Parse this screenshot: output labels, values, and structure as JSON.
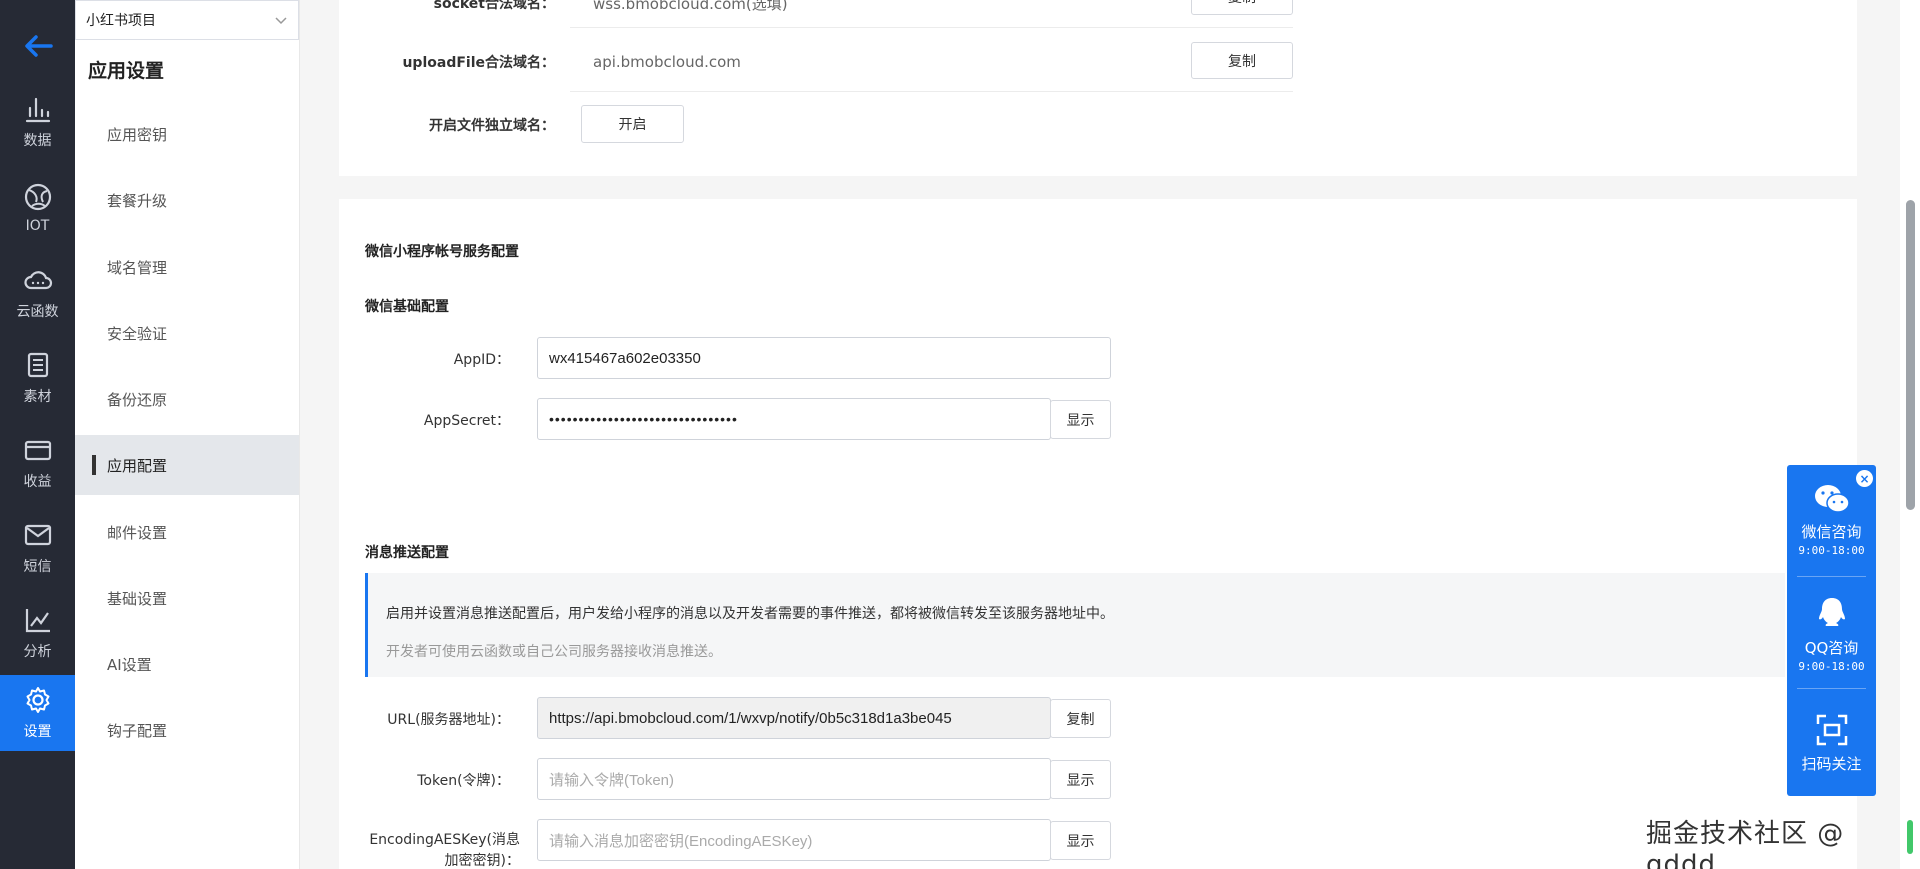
{
  "rail": {
    "items": [
      {
        "label": "数据"
      },
      {
        "label": "IOT"
      },
      {
        "label": "云函数"
      },
      {
        "label": "素材"
      },
      {
        "label": "收益"
      },
      {
        "label": "短信"
      },
      {
        "label": "分析"
      },
      {
        "label": "设置"
      }
    ]
  },
  "project": {
    "selected": "小红书项目"
  },
  "submenu": {
    "title": "应用设置",
    "items": [
      {
        "label": "应用密钥"
      },
      {
        "label": "套餐升级"
      },
      {
        "label": "域名管理"
      },
      {
        "label": "安全验证"
      },
      {
        "label": "备份还原"
      },
      {
        "label": "应用配置"
      },
      {
        "label": "邮件设置"
      },
      {
        "label": "基础设置"
      },
      {
        "label": "AI设置"
      },
      {
        "label": "钩子配置"
      }
    ]
  },
  "domains": {
    "socket_label": "socket合法域名：",
    "socket_value": "wss.bmobcloud.com(选填)",
    "socket_copy": "复制",
    "upload_label": "uploadFile合法域名：",
    "upload_value": "api.bmobcloud.com",
    "upload_copy": "复制",
    "file_domain_label": "开启文件独立域名：",
    "file_domain_button": "开启"
  },
  "wechat": {
    "section_title": "微信小程序帐号服务配置",
    "basic_title": "微信基础配置",
    "appid_label": "AppID：",
    "appid_value": "wx415467a602e03350",
    "appsecret_label": "AppSecret：",
    "appsecret_value": "••••••••••••••••••••••••••••••••",
    "appsecret_show": "显示"
  },
  "push": {
    "section_title": "消息推送配置",
    "notice_line1": "启用并设置消息推送配置后，用户发给小程序的消息以及开发者需要的事件推送，都将被微信转发至该服务器地址中。",
    "notice_line2": "开发者可使用云函数或自己公司服务器接收消息推送。",
    "url_label": "URL(服务器地址)：",
    "url_value": "https://api.bmobcloud.com/1/wxvp/notify/0b5c318d1a3be045",
    "url_copy": "复制",
    "token_label": "Token(令牌)：",
    "token_placeholder": "请输入令牌(Token)",
    "token_show": "显示",
    "aes_label_1": "EncodingAESKey(消息",
    "aes_label_2": "加密密钥)：",
    "aes_placeholder": "请输入消息加密密钥(EncodingAESKey)",
    "aes_show": "显示"
  },
  "float": {
    "wechat_title": "微信咨询",
    "wechat_hours": "9:00-18:00",
    "qq_title": "QQ咨询",
    "qq_hours": "9:00-18:00",
    "scan_title": "扫码关注"
  },
  "watermark": "掘金技术社区 @ qddd"
}
